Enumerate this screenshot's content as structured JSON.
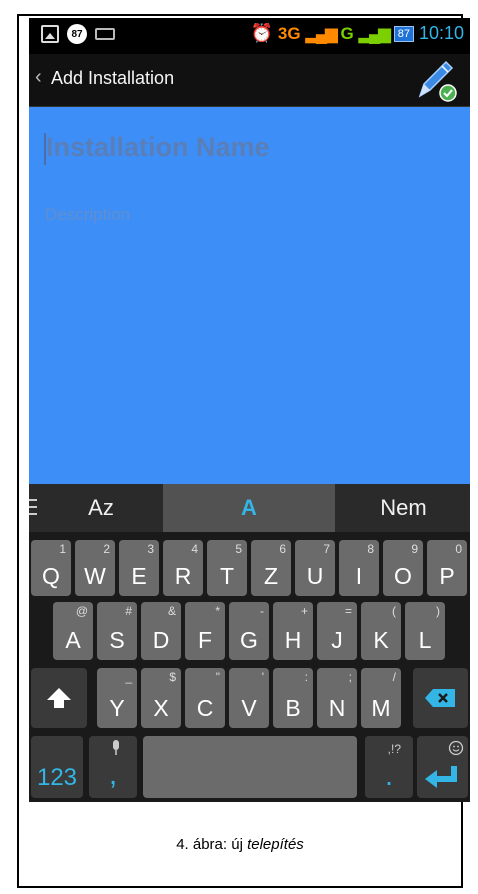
{
  "status_bar": {
    "notification_count": "87",
    "network": "3G",
    "network2": "G",
    "battery": "87",
    "time": "10:10"
  },
  "action_bar": {
    "back_symbol": "‹",
    "title": "Add Installation"
  },
  "form": {
    "name_placeholder": "Installation Name",
    "description_placeholder": "Description"
  },
  "suggestions": {
    "left": "Az",
    "middle": "A",
    "right": "Nem"
  },
  "keyboard": {
    "row1": [
      {
        "key": "Q",
        "alt": "1"
      },
      {
        "key": "W",
        "alt": "2"
      },
      {
        "key": "E",
        "alt": "3"
      },
      {
        "key": "R",
        "alt": "4"
      },
      {
        "key": "T",
        "alt": "5"
      },
      {
        "key": "Z",
        "alt": "6"
      },
      {
        "key": "U",
        "alt": "7"
      },
      {
        "key": "I",
        "alt": "8"
      },
      {
        "key": "O",
        "alt": "9"
      },
      {
        "key": "P",
        "alt": "0"
      }
    ],
    "row2": [
      {
        "key": "A",
        "alt": "@"
      },
      {
        "key": "S",
        "alt": "#"
      },
      {
        "key": "D",
        "alt": "&"
      },
      {
        "key": "F",
        "alt": "*"
      },
      {
        "key": "G",
        "alt": "-"
      },
      {
        "key": "H",
        "alt": "+"
      },
      {
        "key": "J",
        "alt": "="
      },
      {
        "key": "K",
        "alt": "("
      },
      {
        "key": "L",
        "alt": ")"
      }
    ],
    "row3": [
      {
        "key": "Y",
        "alt": "_"
      },
      {
        "key": "X",
        "alt": "$"
      },
      {
        "key": "C",
        "alt": "\""
      },
      {
        "key": "V",
        "alt": "'"
      },
      {
        "key": "B",
        "alt": ":"
      },
      {
        "key": "N",
        "alt": ";"
      },
      {
        "key": "M",
        "alt": "/"
      }
    ],
    "numbers_label": "123",
    "comma": ",",
    "period": ".",
    "period_alt": ",!?",
    "shift_icon": "shift-icon",
    "delete_icon": "backspace-icon",
    "enter_icon": "enter-icon",
    "mic_icon": "mic-icon",
    "emoji_icon": "emoji-icon"
  },
  "caption": {
    "prefix": "4. ábra: új ",
    "emphasis": "telepítés"
  },
  "colors": {
    "content_bg": "#3d8ef7",
    "accent": "#33b5e5"
  }
}
